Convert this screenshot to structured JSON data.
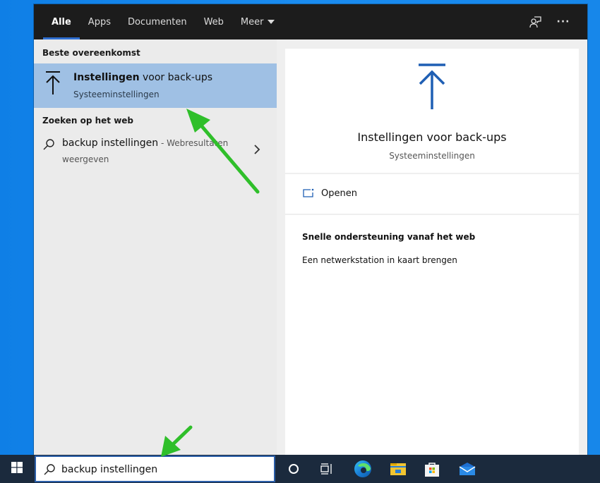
{
  "search_flyout": {
    "tabs": [
      {
        "label": "Alle",
        "active": true
      },
      {
        "label": "Apps",
        "active": false
      },
      {
        "label": "Documenten",
        "active": false
      },
      {
        "label": "Web",
        "active": false
      },
      {
        "label": "Meer",
        "active": false,
        "has_dropdown": true
      }
    ],
    "toolbar_icons": [
      "feedback-icon",
      "more-options-icon"
    ],
    "more_label": "···",
    "left_pane": {
      "best_match_header": "Beste overeenkomst",
      "best_match": {
        "icon": "backup-upload-arrow-icon",
        "title_bold": "Instellingen",
        "title_rest": " voor back-ups",
        "subtitle": "Systeeminstellingen"
      },
      "web_header": "Zoeken op het web",
      "web_result": {
        "icon": "search-icon",
        "query": "backup instellingen",
        "suffix": " - Webresultaten",
        "line2": "weergeven"
      }
    },
    "right_pane": {
      "hero": {
        "icon": "backup-upload-arrow-icon",
        "title": "Instellingen voor back-ups",
        "subtitle": "Systeeminstellingen"
      },
      "actions": [
        {
          "icon": "open-window-icon",
          "label": "Openen"
        }
      ],
      "web_help": {
        "heading": "Snelle ondersteuning vanaf het web",
        "links": [
          "Een netwerkstation in kaart brengen"
        ]
      }
    }
  },
  "taskbar": {
    "search": {
      "value": "backup instellingen",
      "icon": "search-icon"
    },
    "icons": [
      "cortana-icon",
      "task-view-icon",
      "edge-icon",
      "file-explorer-icon",
      "microsoft-store-icon",
      "mail-icon"
    ]
  },
  "colors": {
    "accent": "#2f6fd1",
    "selection": "#9fc0e4",
    "topbar": "#1c1c1c",
    "taskbar": "#1b2a3d",
    "annotation": "#2fbf2a",
    "desktop": "#1787ea"
  }
}
